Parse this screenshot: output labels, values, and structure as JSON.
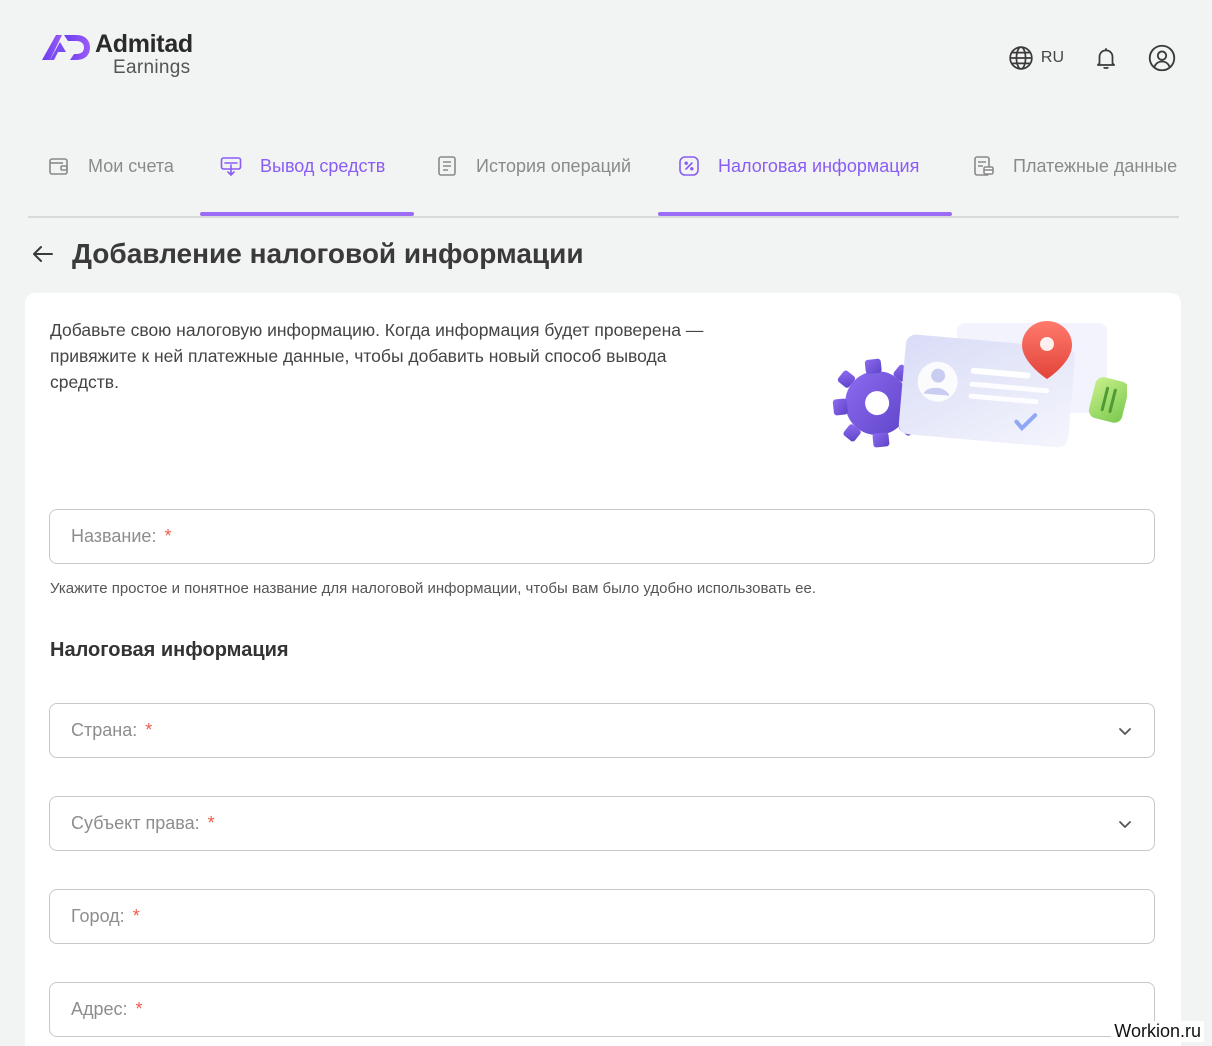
{
  "header": {
    "logo_name": "Admitad",
    "logo_sub": "Earnings",
    "language": "RU"
  },
  "tabs": [
    {
      "label": "Мои счета",
      "active": false,
      "icon": "wallet-icon"
    },
    {
      "label": "Вывод средств",
      "active": true,
      "icon": "withdraw-icon"
    },
    {
      "label": "История операций",
      "active": false,
      "icon": "document-list-icon"
    },
    {
      "label": "Налоговая информация",
      "active": true,
      "icon": "percent-icon"
    },
    {
      "label": "Платежные данные",
      "active": false,
      "icon": "payment-data-icon"
    }
  ],
  "page": {
    "title": "Добавление налоговой информации"
  },
  "card": {
    "intro": "Добавьте свою налоговую информацию. Когда информация будет проверена — привяжите к ней платежные данные, чтобы добавить новый способ вывода средств.",
    "name_field": {
      "label": "Название:",
      "required_mark": "*"
    },
    "name_hint": "Укажите простое и понятное название для налоговой информации, чтобы вам было удобно использовать ее.",
    "section_title": "Налоговая информация",
    "fields": [
      {
        "label": "Страна:",
        "required_mark": "*",
        "type": "select"
      },
      {
        "label": "Субъект права:",
        "required_mark": "*",
        "type": "select"
      },
      {
        "label": "Город:",
        "required_mark": "*",
        "type": "text"
      },
      {
        "label": "Адрес:",
        "required_mark": "*",
        "type": "text"
      }
    ]
  },
  "watermark": "Workion.ru",
  "colors": {
    "accent": "#9b6df6",
    "accent_text": "#8a5cf6",
    "required": "#ef5a4c",
    "background": "#f2f3f3"
  }
}
